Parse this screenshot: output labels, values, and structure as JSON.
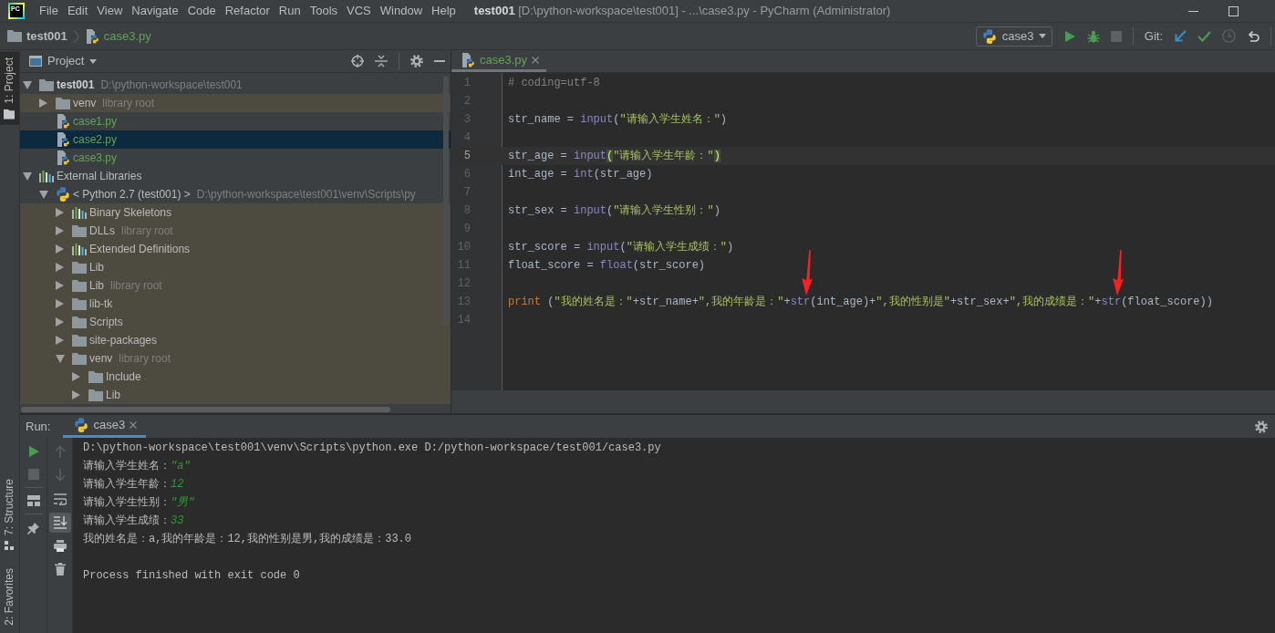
{
  "title_bar": {
    "logo": "PC",
    "menu": [
      {
        "label": "File"
      },
      {
        "label": "Edit"
      },
      {
        "label": "View"
      },
      {
        "label": "Navigate"
      },
      {
        "label": "Code"
      },
      {
        "label": "Refactor"
      },
      {
        "label": "Run"
      },
      {
        "label": "Tools"
      },
      {
        "label": "VCS"
      },
      {
        "label": "Window"
      },
      {
        "label": "Help"
      }
    ],
    "title": "**test001** [D:\\python-workspace\\test001] - ...\\case3.py - PyCharm (Administrator)"
  },
  "navigation_bar": {
    "breadcrumbs": [
      {
        "label": "test001",
        "kind": "folder"
      },
      {
        "label": "case3.py",
        "kind": "python_file"
      }
    ],
    "run_configuration": "case3",
    "stop": {
      "disabled": true
    },
    "vcs_label": "Git:",
    "history": {
      "disabled": true
    }
  },
  "side_strip": {
    "top_tabs": [
      {
        "label": "1: Project",
        "kind": "project",
        "selected": true
      }
    ],
    "bottom_tabs": [
      {
        "label": "7: Structure",
        "kind": "structure",
        "selected": false
      },
      {
        "label": "2: Favorites",
        "kind": "favorites",
        "selected": false
      }
    ]
  },
  "project_panel": {
    "title": "Project",
    "tree": [
      {
        "label": "test001",
        "kind": "project",
        "note": "D:\\python-workspace\\test001",
        "expanded": true,
        "selected": false,
        "library_scope": false,
        "children": [
          {
            "label": "venv",
            "kind": "folder",
            "note": "library root",
            "expanded": false,
            "selected": false,
            "library_scope": true
          },
          {
            "label": "case1.py",
            "kind": "python_file",
            "selected": false,
            "library_scope": false
          },
          {
            "label": "case2.py",
            "kind": "python_file",
            "selected": true,
            "library_scope": false
          },
          {
            "label": "case3.py",
            "kind": "python_file",
            "selected": false,
            "library_scope": false
          }
        ]
      },
      {
        "label": "External Libraries",
        "kind": "libraries",
        "expanded": true,
        "selected": false,
        "library_scope": false,
        "children": [
          {
            "label": "< Python 2.7 (test001) >",
            "kind": "sdk",
            "note": "D:\\python-workspace\\test001\\venv\\Scripts\\py",
            "expanded": true,
            "selected": false,
            "library_scope": false,
            "children": [
              {
                "label": "Binary Skeletons",
                "kind": "libraries",
                "expanded": false,
                "selected": false,
                "library_scope": true
              },
              {
                "label": "DLLs",
                "kind": "folder",
                "note": "library root",
                "expanded": false,
                "selected": false,
                "library_scope": true
              },
              {
                "label": "Extended Definitions",
                "kind": "libraries",
                "expanded": false,
                "selected": false,
                "library_scope": true
              },
              {
                "label": "Lib",
                "kind": "folder",
                "expanded": false,
                "selected": false,
                "library_scope": true
              },
              {
                "label": "Lib",
                "kind": "folder",
                "note": "library root",
                "expanded": false,
                "selected": false,
                "library_scope": true
              },
              {
                "label": "lib-tk",
                "kind": "folder",
                "expanded": false,
                "selected": false,
                "library_scope": true
              },
              {
                "label": "Scripts",
                "kind": "folder",
                "expanded": false,
                "selected": false,
                "library_scope": true
              },
              {
                "label": "site-packages",
                "kind": "folder",
                "expanded": false,
                "selected": false,
                "library_scope": true
              },
              {
                "label": "venv",
                "kind": "folder",
                "note": "library root",
                "expanded": true,
                "selected": false,
                "library_scope": true,
                "children": [
                  {
                    "label": "Include",
                    "kind": "folder",
                    "expanded": false,
                    "selected": false,
                    "library_scope": true
                  },
                  {
                    "label": "Lib",
                    "kind": "folder",
                    "expanded": false,
                    "selected": false,
                    "library_scope": true
                  }
                ]
              }
            ]
          }
        ]
      }
    ]
  },
  "editor": {
    "tabs": [
      {
        "label": "case3.py",
        "selected": true
      }
    ],
    "lines": [
      {
        "number": "1",
        "current": false,
        "tokens": [
          {
            "text": "# coding=utf-8",
            "kind": "comment"
          }
        ]
      },
      {
        "number": "2",
        "current": false
      },
      {
        "number": "3",
        "current": false,
        "tokens": [
          {
            "text": "str_name = ",
            "kind": "plain"
          },
          {
            "text": "input",
            "kind": "builtin"
          },
          {
            "text": "(",
            "kind": "plain"
          },
          {
            "text": "\"请输入学生姓名：\"",
            "kind": "string"
          },
          {
            "text": ")",
            "kind": "plain"
          }
        ]
      },
      {
        "number": "4",
        "current": false
      },
      {
        "number": "5",
        "current": true,
        "tokens": [
          {
            "text": "str_age = ",
            "kind": "plain"
          },
          {
            "text": "input",
            "kind": "builtin"
          },
          {
            "text": "(",
            "kind": "brace_match"
          },
          {
            "text": "\"请输入学生年龄：\"",
            "kind": "string"
          },
          {
            "text": ")",
            "kind": "brace_match"
          }
        ]
      },
      {
        "number": "6",
        "current": false,
        "tokens": [
          {
            "text": "int_age = ",
            "kind": "plain"
          },
          {
            "text": "int",
            "kind": "builtin"
          },
          {
            "text": "(str_age)",
            "kind": "plain"
          }
        ]
      },
      {
        "number": "7",
        "current": false
      },
      {
        "number": "8",
        "current": false,
        "tokens": [
          {
            "text": "str_sex = ",
            "kind": "plain"
          },
          {
            "text": "input",
            "kind": "builtin"
          },
          {
            "text": "(",
            "kind": "plain"
          },
          {
            "text": "\"请输入学生性别：\"",
            "kind": "string"
          },
          {
            "text": ")",
            "kind": "plain"
          }
        ]
      },
      {
        "number": "9",
        "current": false
      },
      {
        "number": "10",
        "current": false,
        "tokens": [
          {
            "text": "str_score = ",
            "kind": "plain"
          },
          {
            "text": "input",
            "kind": "builtin"
          },
          {
            "text": "(",
            "kind": "plain"
          },
          {
            "text": "\"请输入学生成绩：\"",
            "kind": "string"
          },
          {
            "text": ")",
            "kind": "plain"
          }
        ]
      },
      {
        "number": "11",
        "current": false,
        "tokens": [
          {
            "text": "float_score = ",
            "kind": "plain"
          },
          {
            "text": "float",
            "kind": "builtin"
          },
          {
            "text": "(str_score)",
            "kind": "plain"
          }
        ]
      },
      {
        "number": "12",
        "current": false
      },
      {
        "number": "13",
        "current": false,
        "tokens": [
          {
            "text": "print",
            "kind": "keyword"
          },
          {
            "text": " (",
            "kind": "plain"
          },
          {
            "text": "\"我的姓名是：\"",
            "kind": "string"
          },
          {
            "text": "+str_name+",
            "kind": "plain"
          },
          {
            "text": "\",我的年龄是：\"",
            "kind": "string"
          },
          {
            "text": "+",
            "kind": "plain"
          },
          {
            "text": "str",
            "kind": "builtin",
            "arrow": true
          },
          {
            "text": "(int_age)+",
            "kind": "plain"
          },
          {
            "text": "\",我的性别是\"",
            "kind": "string"
          },
          {
            "text": "+str_sex+",
            "kind": "plain"
          },
          {
            "text": "\",我的成绩是：\"",
            "kind": "string"
          },
          {
            "text": "+",
            "kind": "plain"
          },
          {
            "text": "str",
            "kind": "builtin",
            "arrow": true
          },
          {
            "text": "(float_score))",
            "kind": "plain"
          }
        ]
      },
      {
        "number": "14",
        "current": false
      }
    ]
  },
  "run_panel": {
    "label": "Run:",
    "tabs": [
      {
        "label": "case3",
        "selected": true
      }
    ],
    "stop": {
      "disabled": true
    },
    "previous": {
      "disabled": true
    },
    "next": {
      "disabled": true
    },
    "scroll_to_end": {
      "on": true
    },
    "console": [
      {
        "segments": [
          {
            "text": "D:\\python-workspace\\test001\\venv\\Scripts\\python.exe D:/python-workspace/test001/case3.py",
            "kind": "output"
          }
        ]
      },
      {
        "segments": [
          {
            "text": "请输入学生姓名：",
            "kind": "output"
          },
          {
            "text": "\"a\"",
            "kind": "input"
          }
        ]
      },
      {
        "segments": [
          {
            "text": "请输入学生年龄：",
            "kind": "output"
          },
          {
            "text": "12",
            "kind": "input"
          }
        ]
      },
      {
        "segments": [
          {
            "text": "请输入学生性别：",
            "kind": "output"
          },
          {
            "text": "\"男\"",
            "kind": "input"
          }
        ]
      },
      {
        "segments": [
          {
            "text": "请输入学生成绩：",
            "kind": "output"
          },
          {
            "text": "33",
            "kind": "input"
          }
        ]
      },
      {
        "segments": [
          {
            "text": "我的姓名是：a,我的年龄是：12,我的性别是男,我的成绩是：33.0",
            "kind": "output"
          }
        ]
      },
      {
        "gap_before": true,
        "segments": [
          {
            "text": "Process finished with exit code 0",
            "kind": "output"
          }
        ]
      }
    ]
  }
}
